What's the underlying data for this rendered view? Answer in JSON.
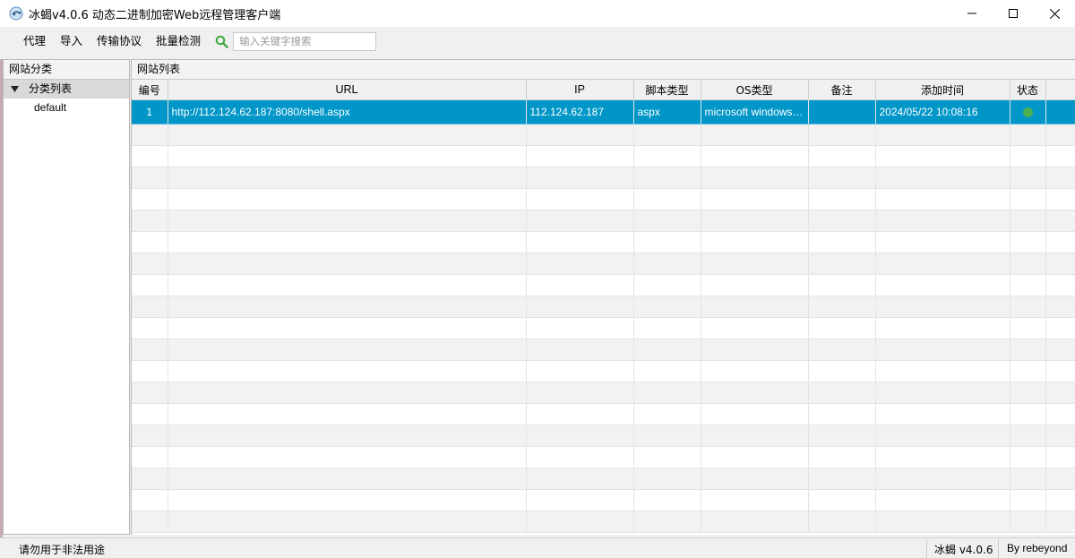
{
  "window": {
    "title": "冰蝎v4.0.6 动态二进制加密Web远程管理客户端",
    "icon": "scorpion-app-icon"
  },
  "menu": {
    "items": [
      "代理",
      "导入",
      "传输协议",
      "批量检测"
    ]
  },
  "search": {
    "placeholder": "输入关键字搜索",
    "value": "",
    "icon_color": "#3da83d"
  },
  "left_panel": {
    "header": "网站分类",
    "tree_root_label": "分类列表",
    "tree_children": [
      "default"
    ]
  },
  "right_panel": {
    "header": "网站列表",
    "columns": [
      "编号",
      "URL",
      "IP",
      "脚本类型",
      "OS类型",
      "备注",
      "添加时间",
      "状态"
    ],
    "rows": [
      {
        "id": "1",
        "url": "http://112.124.62.187:8080/shell.aspx",
        "ip": "112.124.62.187",
        "script_type": "aspx",
        "os_type": "microsoft windows ...",
        "note": "",
        "added_time": "2024/05/22 10:08:16",
        "status_color": "#4caf50",
        "selected": true
      }
    ],
    "selection_color": "#0096c8"
  },
  "statusbar": {
    "notice": "请勿用于非法用途",
    "version": "冰蝎 v4.0.6",
    "author": "By rebeyond"
  }
}
